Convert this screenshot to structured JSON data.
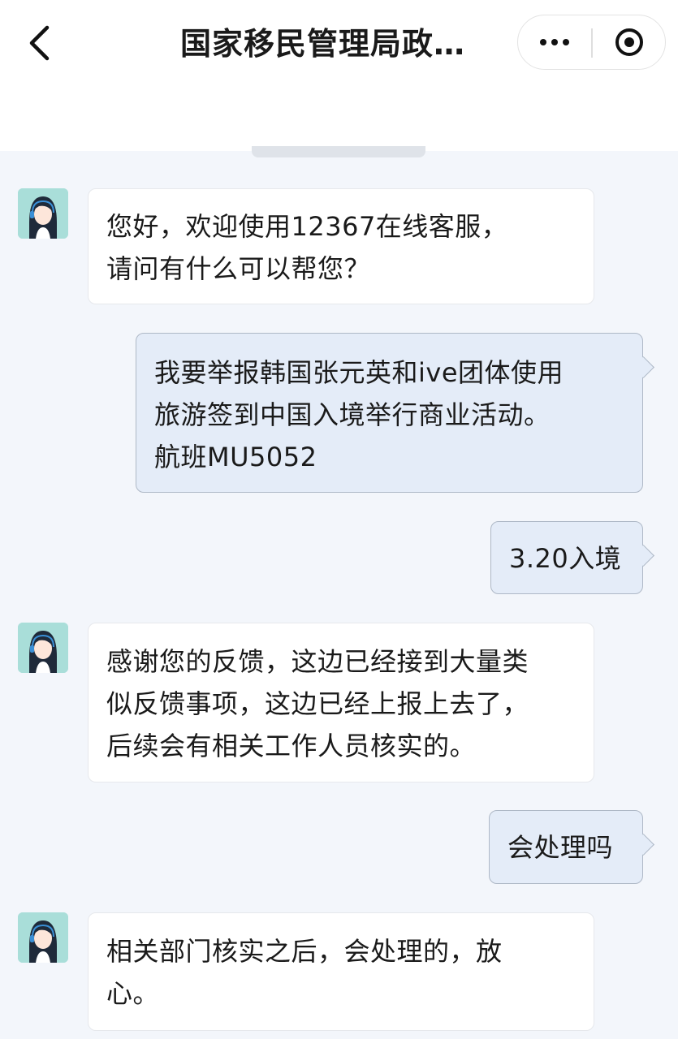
{
  "header": {
    "title": "国家移民管理局政…",
    "back_icon": "chevron-left-icon",
    "more_icon": "more-dots-icon",
    "close_icon": "target-circle-icon"
  },
  "messages": [
    {
      "from": "agent",
      "text": " 您好，欢迎使用12367在线客服，\n请问有什么可以帮您？"
    },
    {
      "from": "user",
      "text": "我要举报韩国张元英和ive团体使用\n旅游签到中国入境举行商业活动。\n航班MU5052"
    },
    {
      "from": "user",
      "text": "3.20入境"
    },
    {
      "from": "agent",
      "text": "感谢您的反馈，这边已经接到大量类\n似反馈事项，这边已经上报上去了，\n后续会有相关工作人员核实的。"
    },
    {
      "from": "user",
      "text": "会处理吗"
    },
    {
      "from": "agent",
      "text": "相关部门核实之后，会处理的，放\n心。"
    }
  ],
  "colors": {
    "page_bg": "#f3f6fb",
    "agent_bubble": "#ffffff",
    "user_bubble": "#e4ecf8",
    "user_border": "#aeb8c6",
    "avatar_bg": "#a9ded9"
  }
}
